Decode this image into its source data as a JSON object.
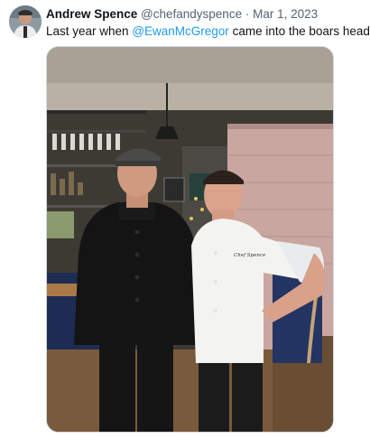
{
  "tweet": {
    "author_name": "Andrew Spence",
    "handle": "@chefandyspence",
    "separator": "·",
    "date": "Mar 1, 2023",
    "text_before": "Last year when ",
    "mention": "@EwanMcGregor",
    "text_after": " came into the boars head.",
    "chef_jacket_text": "Chef Spence"
  },
  "colors": {
    "link": "#1d9bf0",
    "secondary_text": "#536471",
    "primary_text": "#0f1419"
  }
}
